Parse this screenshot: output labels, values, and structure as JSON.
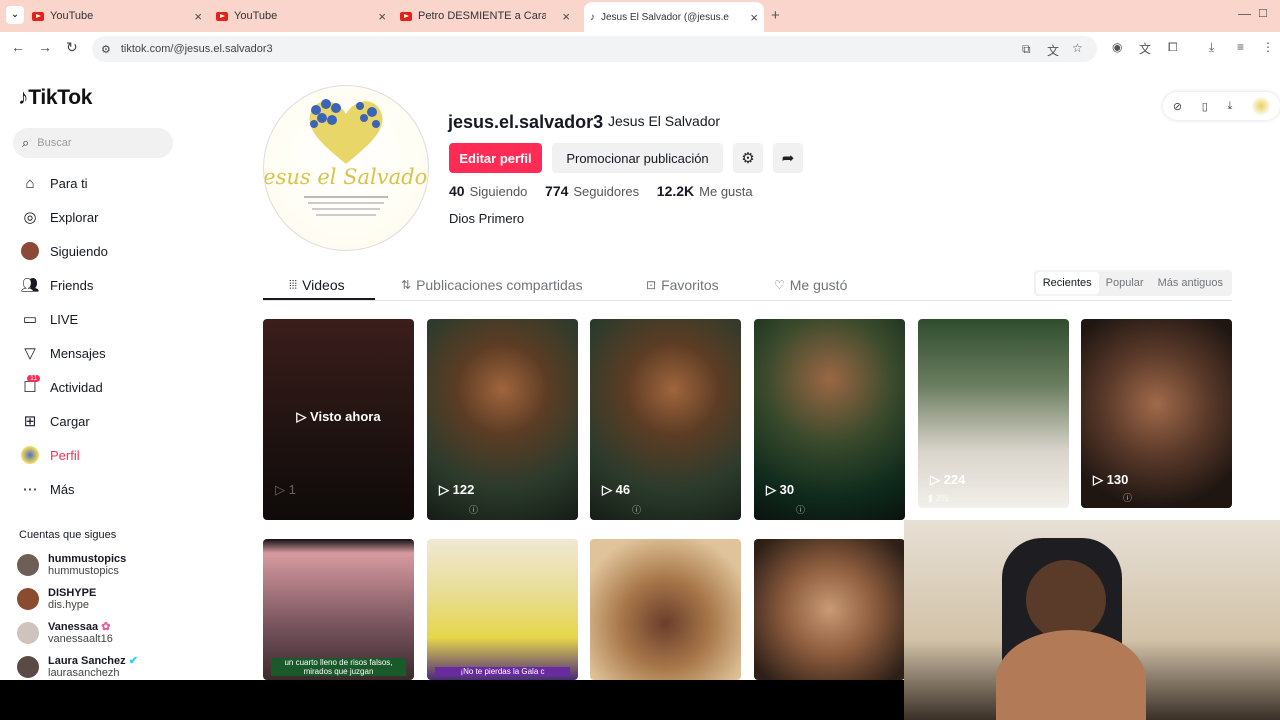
{
  "browser": {
    "tabs": [
      {
        "title": "YouTube",
        "type": "youtube"
      },
      {
        "title": "YouTube",
        "type": "youtube"
      },
      {
        "title": "Petro DESMIENTE a Caracol po",
        "type": "youtube"
      },
      {
        "title": "Jesus El Salvador (@jesus.el.salv",
        "type": "tiktok"
      }
    ],
    "url": "tiktok.com/@jesus.el.salvador3"
  },
  "sidebar": {
    "logo": "TikTok",
    "search_placeholder": "Buscar",
    "nav": [
      {
        "label": "Para ti",
        "icon": "home-icon"
      },
      {
        "label": "Explorar",
        "icon": "compass-icon"
      },
      {
        "label": "Siguiendo",
        "icon": "following-avatar-icon"
      },
      {
        "label": "Friends",
        "icon": "friends-icon"
      },
      {
        "label": "LIVE",
        "icon": "live-icon"
      },
      {
        "label": "Mensajes",
        "icon": "messages-icon"
      },
      {
        "label": "Actividad",
        "icon": "activity-icon",
        "badge": "11"
      },
      {
        "label": "Cargar",
        "icon": "upload-icon"
      },
      {
        "label": "Perfil",
        "icon": "profile-icon"
      },
      {
        "label": "Más",
        "icon": "more-icon"
      }
    ],
    "following_header": "Cuentas que sigues",
    "following": [
      {
        "name": "hummustopics",
        "handle": "hummustopics"
      },
      {
        "name": "DISHYPE",
        "handle": "dis.hype"
      },
      {
        "name": "Vanessaa",
        "handle": "vanessaalt16"
      },
      {
        "name": "Laura Sanchez",
        "handle": "laurasanchezh"
      }
    ]
  },
  "profile": {
    "username": "jesus.el.salvador3",
    "nickname": "Jesus El Salvador",
    "edit_label": "Editar perfil",
    "promote_label": "Promocionar publicación",
    "following_count": "40",
    "following_label": "Siguiendo",
    "followers_count": "774",
    "followers_label": "Seguidores",
    "likes_count": "12.2K",
    "likes_label": "Me gusta",
    "bio": "Dios Primero",
    "avatar_script": "Jesus el Salvador"
  },
  "content_tabs": [
    "Videos",
    "Publicaciones compartidas",
    "Favoritos",
    "Me gustó"
  ],
  "sort": [
    "Recientes",
    "Popular",
    "Más antiguos"
  ],
  "videos": [
    {
      "views": "1",
      "overlay": "Visto ahora"
    },
    {
      "views": "122"
    },
    {
      "views": "46"
    },
    {
      "views": "30"
    },
    {
      "views": "224",
      "sub": "3%"
    },
    {
      "views": "130"
    }
  ],
  "videos_row2_captions": [
    "un cuarto lleno de risos falsos, mirados que juzgan",
    "¡No te pierdas la Gala c"
  ],
  "colors": {
    "accent": "#fe2c55",
    "text": "#161823"
  }
}
